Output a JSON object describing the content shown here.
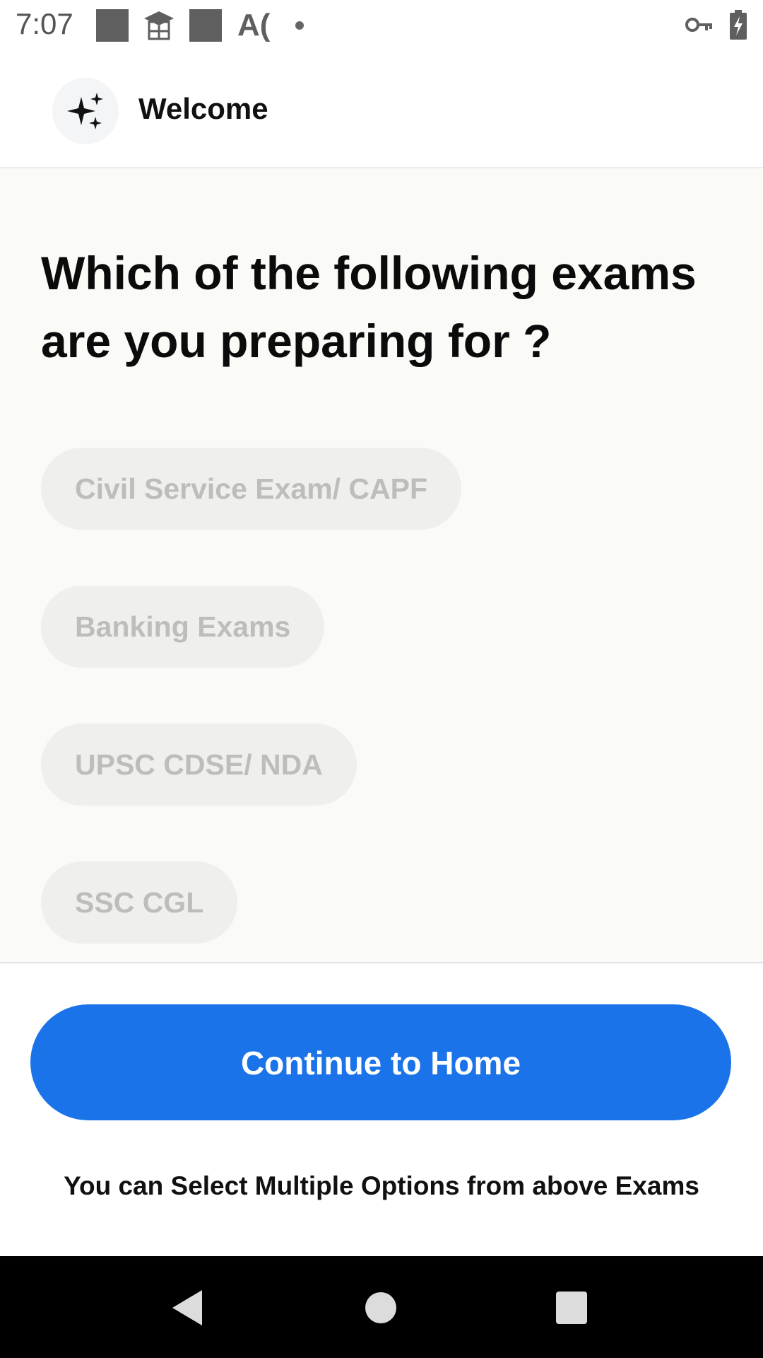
{
  "status_bar": {
    "time": "7:07",
    "icons": [
      "notification-square-icon",
      "graduation-cap-icon",
      "notification-square-icon",
      "ai-app-icon",
      "dot-icon",
      "vpn-key-icon",
      "battery-charging-icon"
    ],
    "ai_label": "A("
  },
  "header": {
    "title": "Welcome",
    "icon": "sparkles-icon"
  },
  "question": {
    "line1": "Which of the following exams",
    "line2": "are you preparing for ?"
  },
  "options": [
    {
      "label": "Civil Service Exam/ CAPF",
      "selected": false
    },
    {
      "label": "Banking Exams",
      "selected": false
    },
    {
      "label": "UPSC CDSE/ NDA",
      "selected": false
    },
    {
      "label": "SSC CGL",
      "selected": false
    }
  ],
  "cta": {
    "label": "Continue to Home"
  },
  "hint": "You can Select Multiple Options from above Exams",
  "nav_bar": {
    "icons": [
      "back-icon",
      "home-icon",
      "recents-icon"
    ]
  },
  "colors": {
    "accent": "#1a73e8",
    "option_bg": "#efefed",
    "option_text": "#bdbdbb",
    "content_bg": "#fafaf7"
  }
}
